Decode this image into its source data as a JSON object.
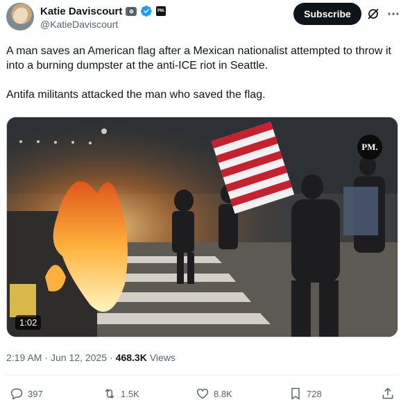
{
  "author": {
    "display_name": "Katie Daviscourt",
    "handle": "@KatieDaviscourt",
    "badges": [
      "camera-icon",
      "verified-icon",
      "pm-badge"
    ],
    "pm_badge_text": "PM."
  },
  "header": {
    "subscribe_label": "Subscribe"
  },
  "tweet": {
    "paragraphs": [
      "A man saves an American flag after a Mexican nationalist attempted to throw it into a burning dumpster at the anti-ICE riot in Seattle.",
      "Antifa militants attacked the man who saved the flag."
    ]
  },
  "media": {
    "watermark": "PM.",
    "duration": "1:02"
  },
  "meta": {
    "time": "2:19 AM",
    "separator": "·",
    "date": "Jun 12, 2025",
    "views_count": "468.3K",
    "views_label": "Views"
  },
  "actions": {
    "replies": "397",
    "reposts": "1.5K",
    "likes": "8.8K",
    "bookmarks": "728"
  },
  "colors": {
    "text_primary": "#0f1419",
    "text_secondary": "#536471",
    "verified_blue": "#1d9bf0",
    "subscribe_bg": "#0f1419"
  }
}
